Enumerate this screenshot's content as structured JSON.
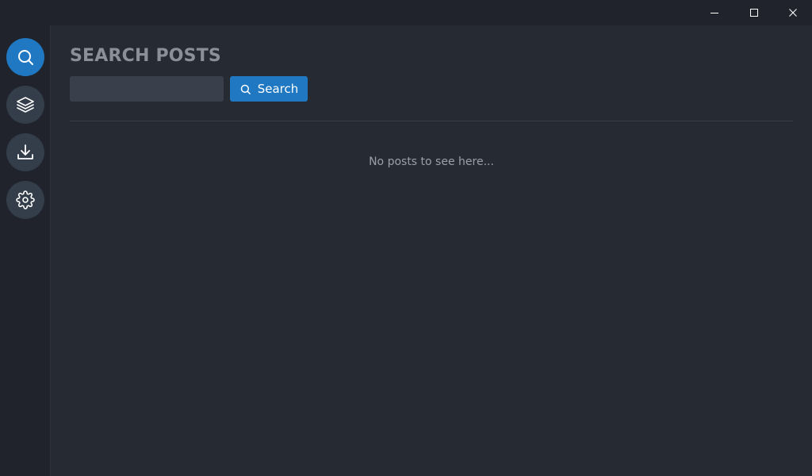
{
  "window": {
    "controls": [
      "minimize-icon",
      "maximize-icon",
      "close-icon"
    ],
    "icon_color": "#ffffff"
  },
  "sidebar": {
    "items": [
      {
        "name": "search",
        "icon": "search-icon",
        "active": true
      },
      {
        "name": "layers",
        "icon": "layers-icon",
        "active": false
      },
      {
        "name": "downloads",
        "icon": "download-icon",
        "active": false
      },
      {
        "name": "settings",
        "icon": "gear-icon",
        "active": false
      }
    ],
    "active_color": "#1f78c1",
    "inactive_color": "#343d4a"
  },
  "main": {
    "title": "SEARCH POSTS",
    "search": {
      "value": "",
      "placeholder": "",
      "button_label": "Search",
      "button_icon": "search-icon"
    },
    "empty_message": "No posts to see here..."
  },
  "colors": {
    "background": "#262a33",
    "sidebar": "#20232b",
    "accent": "#1f78c1"
  }
}
